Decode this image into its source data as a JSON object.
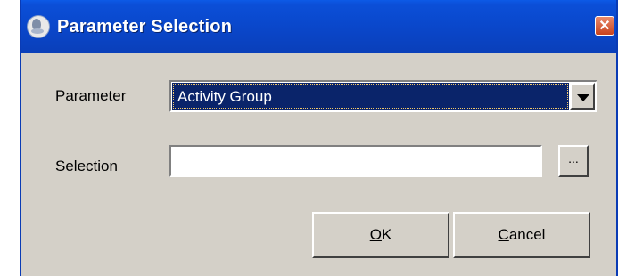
{
  "window": {
    "title": "Parameter Selection",
    "close_symbol": "✕",
    "title_icon": "app-icon"
  },
  "form": {
    "parameter_label": "Parameter",
    "parameter_value": "Activity Group",
    "selection_label": "Selection",
    "selection_value": "",
    "browse_label": "..."
  },
  "buttons": {
    "ok_mnemonic": "O",
    "ok_rest": "K",
    "cancel_mnemonic": "C",
    "cancel_rest": "ancel"
  },
  "colors": {
    "titlebar": "#0a46c9",
    "selection_highlight": "#0a246a",
    "dialog_face": "#d4d0c8"
  }
}
